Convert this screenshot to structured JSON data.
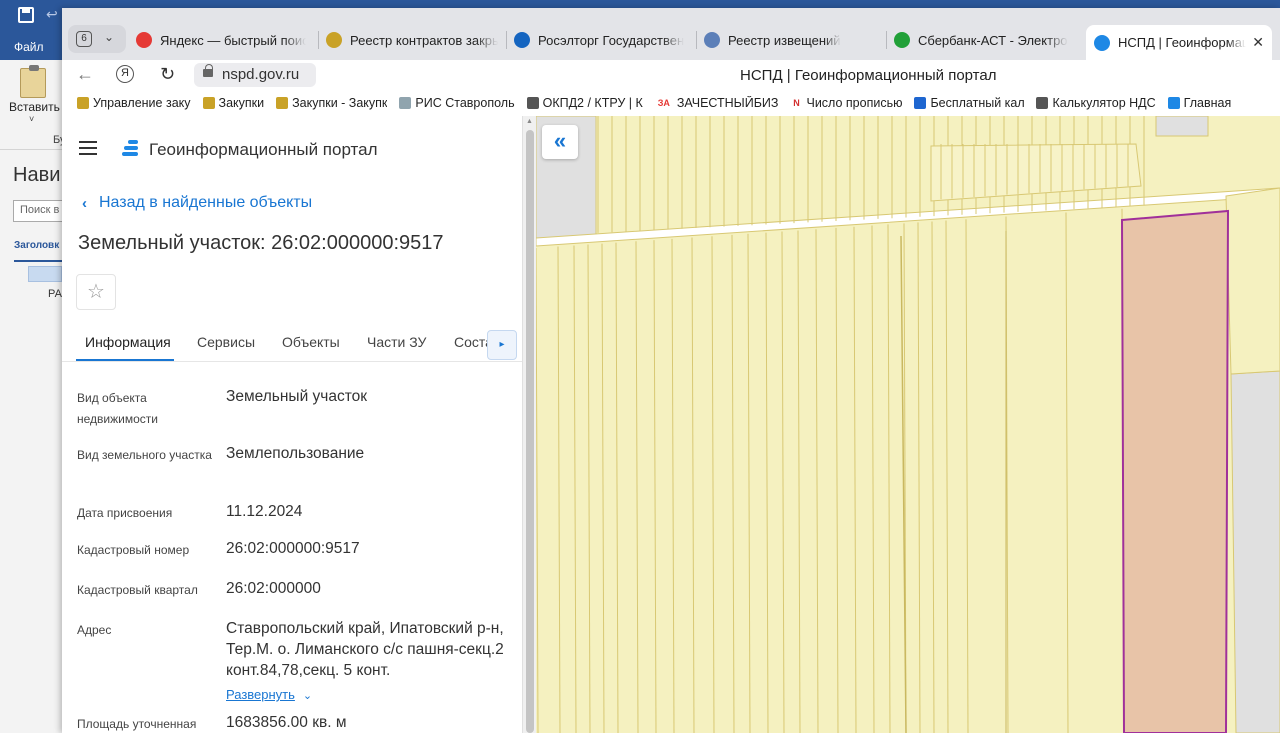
{
  "word": {
    "file_tab": "Файл",
    "paste_label": "Вставить",
    "buffer_label": "Бу",
    "nav_title": "Нави",
    "nav_search_placeholder": "Поиск в",
    "nav_headings_tab": "Заголовк",
    "nav_item_text": "РА"
  },
  "browser": {
    "tab_count": "6",
    "tabs": [
      {
        "label": "Яндекс — быстрый поиск",
        "icon": "yandex-icon",
        "color": "#e53935"
      },
      {
        "label": "Реестр контрактов закры",
        "icon": "emblem-icon",
        "color": "#c9a227"
      },
      {
        "label": "Росэлторг Государствен",
        "icon": "roseltorg-icon",
        "color": "#1565c0"
      },
      {
        "label": "Реестр извещений",
        "icon": "eagle-icon",
        "color": "#5c7fb8"
      },
      {
        "label": "Сбербанк-АСТ - Электро",
        "icon": "sber-icon",
        "color": "#21a038"
      },
      {
        "label": "НСПД | Геоинформаци",
        "icon": "nspd-icon",
        "color": "#1e88e5",
        "active": true
      }
    ],
    "url": "nspd.gov.ru",
    "page_title": "НСПД | Геоинформационный портал",
    "bookmarks": [
      {
        "label": "Управление заку",
        "icon": "emblem-icon",
        "color": "#c9a227"
      },
      {
        "label": "Закупки",
        "icon": "eagle-icon",
        "color": "#c9a227"
      },
      {
        "label": "Закупки - Закупк",
        "icon": "emblem-icon",
        "color": "#c9a227"
      },
      {
        "label": "РИС Ставрополь",
        "icon": "cloud-icon",
        "color": "#90a4ae"
      },
      {
        "label": "ОКПД2 / КТРУ | К",
        "icon": "doc-icon",
        "color": "#555555"
      },
      {
        "label": "ЗАЧЕСТНЫЙБИЗ",
        "icon": "za-icon",
        "color": "#e53935",
        "badge": "ЗА"
      },
      {
        "label": "Число прописью",
        "icon": "n-icon",
        "color": "#d32f2f",
        "badge": "N"
      },
      {
        "label": "Бесплатный каль",
        "icon": "calc-blue-icon",
        "color": "#1e66d0"
      },
      {
        "label": "Калькулятор НДС",
        "icon": "calculator-icon",
        "color": "#555555"
      },
      {
        "label": "Главная",
        "icon": "site-icon",
        "color": "#1e88e5"
      }
    ]
  },
  "portal": {
    "name": "Геоинформационный портал",
    "back_label": "Назад в найденные объекты",
    "object_title": "Земельный участок: 26:02:000000:9517",
    "tabs": [
      "Информация",
      "Сервисы",
      "Объекты",
      "Части ЗУ",
      "Соста"
    ],
    "active_tab": "Информация",
    "info": [
      {
        "label": "Вид объекта недвижимости",
        "value": "Земельный участок"
      },
      {
        "label": "Вид земельного участка",
        "value": "Землепользование"
      },
      {
        "label": "Дата присвоения",
        "value": "11.12.2024"
      },
      {
        "label": "Кадастровый номер",
        "value": "26:02:000000:9517"
      },
      {
        "label": "Кадастровый квартал",
        "value": "26:02:000000"
      },
      {
        "label": "Адрес",
        "value": "Ставропольский край, Ипатовский р-н, Тер.М. о. Лиманского с/с пашня-секц.2 конт.84,78,секц. 5 конт."
      },
      {
        "label": "Площадь уточненная",
        "value": "1683856.00 кв. м"
      }
    ],
    "expand_label": "Развернуть"
  },
  "map": {
    "parcel_fill": "#f5f1c0",
    "parcel_stroke": "#d8c873",
    "selected_fill": "#e8c4a8",
    "selected_stroke": "#a0309a",
    "blank_fill": "#e0e0e0"
  }
}
